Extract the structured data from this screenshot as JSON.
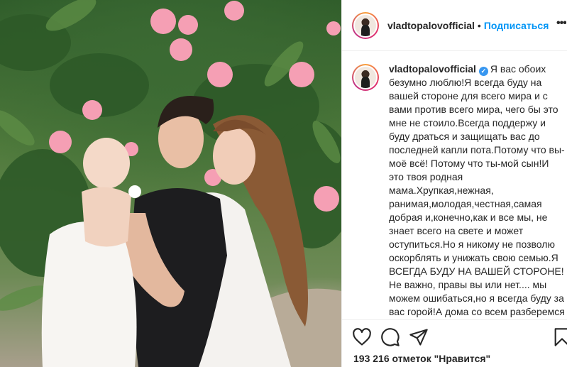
{
  "post": {
    "image_alt": "Family photo among oleander flowers"
  },
  "header": {
    "username": "vladtopalovofficial",
    "separator": "•",
    "follow_label": "Подписаться",
    "more_icon": "more-icon"
  },
  "caption": {
    "username": "vladtopalovofficial",
    "verified_icon": "verified-badge-icon",
    "text": "Я вас обоих безумно люблю!Я всегда буду на вашей стороне для всего мира и с вами против всего мира, чего бы это мне не стоило.Всегда поддержу и буду драться и защищать вас до последней капли пота.Потому что вы-моё всё! Потому что ты-мой сын!И это твоя родная мама.Хрупкая,нежная, ранимая,молодая,честная,самая добрая и,конечно,как и все мы, не знает всего на свете и может оступиться.Но я никому не позволю оскорблять и унижать свою семью.Я ВСЕГДА БУДУ НА ВАШЕЙ СТОРОНЕ!Не важно, правы вы или нет.... мы можем ошибаться,но я всегда буду за вас горой!А дома со всем разберемся"
  },
  "actions": {
    "like_icon": "heart-icon",
    "comment_icon": "comment-icon",
    "share_icon": "share-icon",
    "save_icon": "bookmark-icon",
    "likes_label": "193 216 отметок \"Нравится\""
  },
  "colors": {
    "accent": "#0095f6",
    "verified": "#3897f0",
    "text": "#262626",
    "border": "#efefef"
  }
}
